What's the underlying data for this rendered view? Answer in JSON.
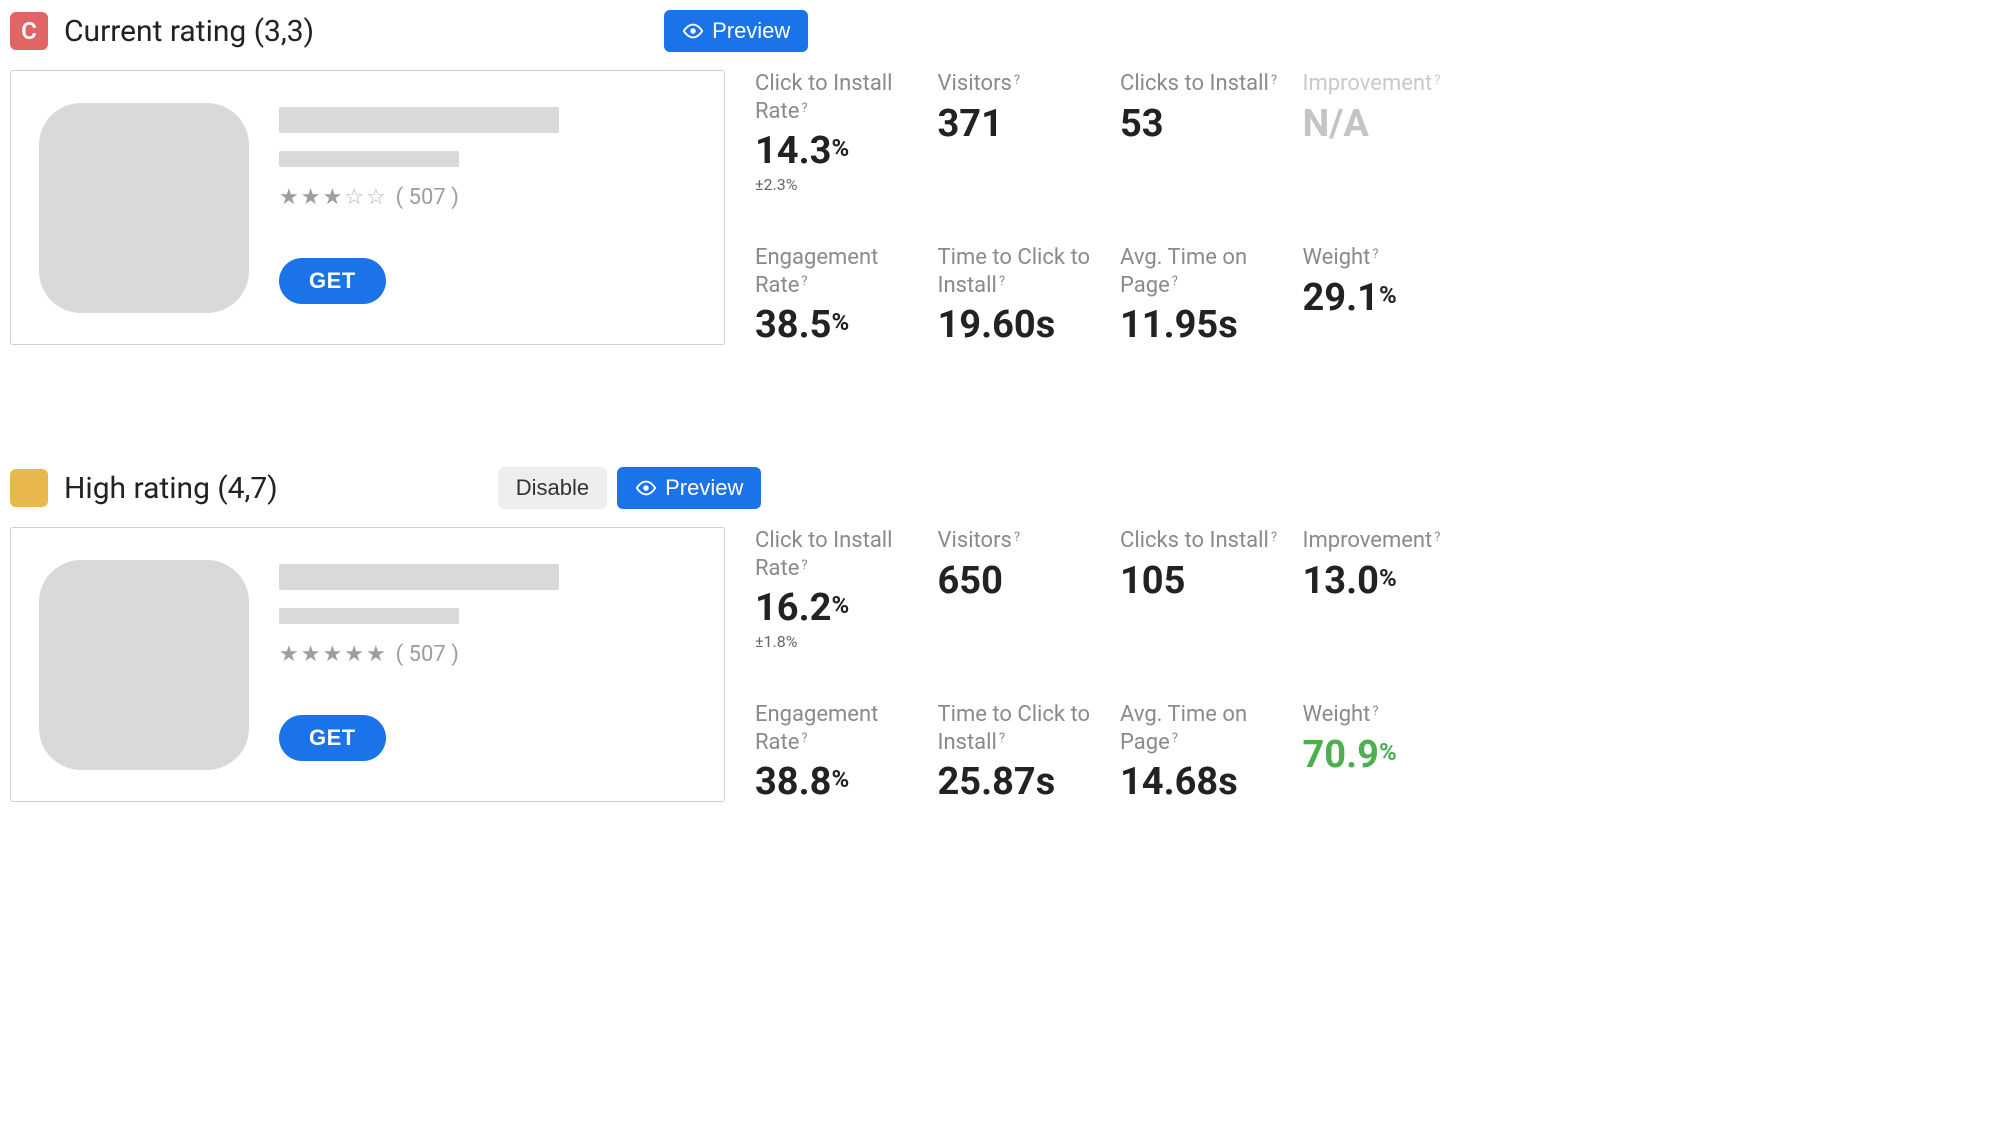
{
  "common": {
    "preview_label": "Preview",
    "disable_label": "Disable",
    "get_label": "GET",
    "rating_count": "( 507 )",
    "metric_labels": {
      "click_install_rate": "Click to Install Rate",
      "visitors": "Visitors",
      "clicks_to_install": "Clicks to Install",
      "improvement": "Improvement",
      "engagement_rate": "Engagement Rate",
      "time_to_click": "Time to Click to Install",
      "avg_time_on_page": "Avg. Time on Page",
      "weight": "Weight"
    }
  },
  "variants": {
    "a": {
      "badge_letter": "C",
      "badge_color": "#e06666",
      "title": "Current rating (3,3)",
      "has_disable": false,
      "star_rating": 3.0,
      "metrics": {
        "click_install_rate": {
          "v": "14.3",
          "pct": true,
          "sub": "±2.3%"
        },
        "visitors": {
          "v": "371"
        },
        "clicks_to_install": {
          "v": "53"
        },
        "improvement": {
          "v": "N/A",
          "dim": true
        },
        "engagement_rate": {
          "v": "38.5",
          "pct": true
        },
        "time_to_click": {
          "v": "19.60s"
        },
        "avg_time_on_page": {
          "v": "11.95s"
        },
        "weight": {
          "v": "29.1",
          "pct": true
        }
      }
    },
    "b": {
      "badge_letter": "",
      "badge_color": "#e8b84f",
      "title": "High rating (4,7)",
      "has_disable": true,
      "star_rating": 4.7,
      "metrics": {
        "click_install_rate": {
          "v": "16.2",
          "pct": true,
          "sub": "±1.8%"
        },
        "visitors": {
          "v": "650"
        },
        "clicks_to_install": {
          "v": "105"
        },
        "improvement": {
          "v": "13.0",
          "pct": true
        },
        "engagement_rate": {
          "v": "38.8",
          "pct": true
        },
        "time_to_click": {
          "v": "25.87s"
        },
        "avg_time_on_page": {
          "v": "14.68s"
        },
        "weight": {
          "v": "70.9",
          "pct": true,
          "green": true
        }
      }
    }
  }
}
